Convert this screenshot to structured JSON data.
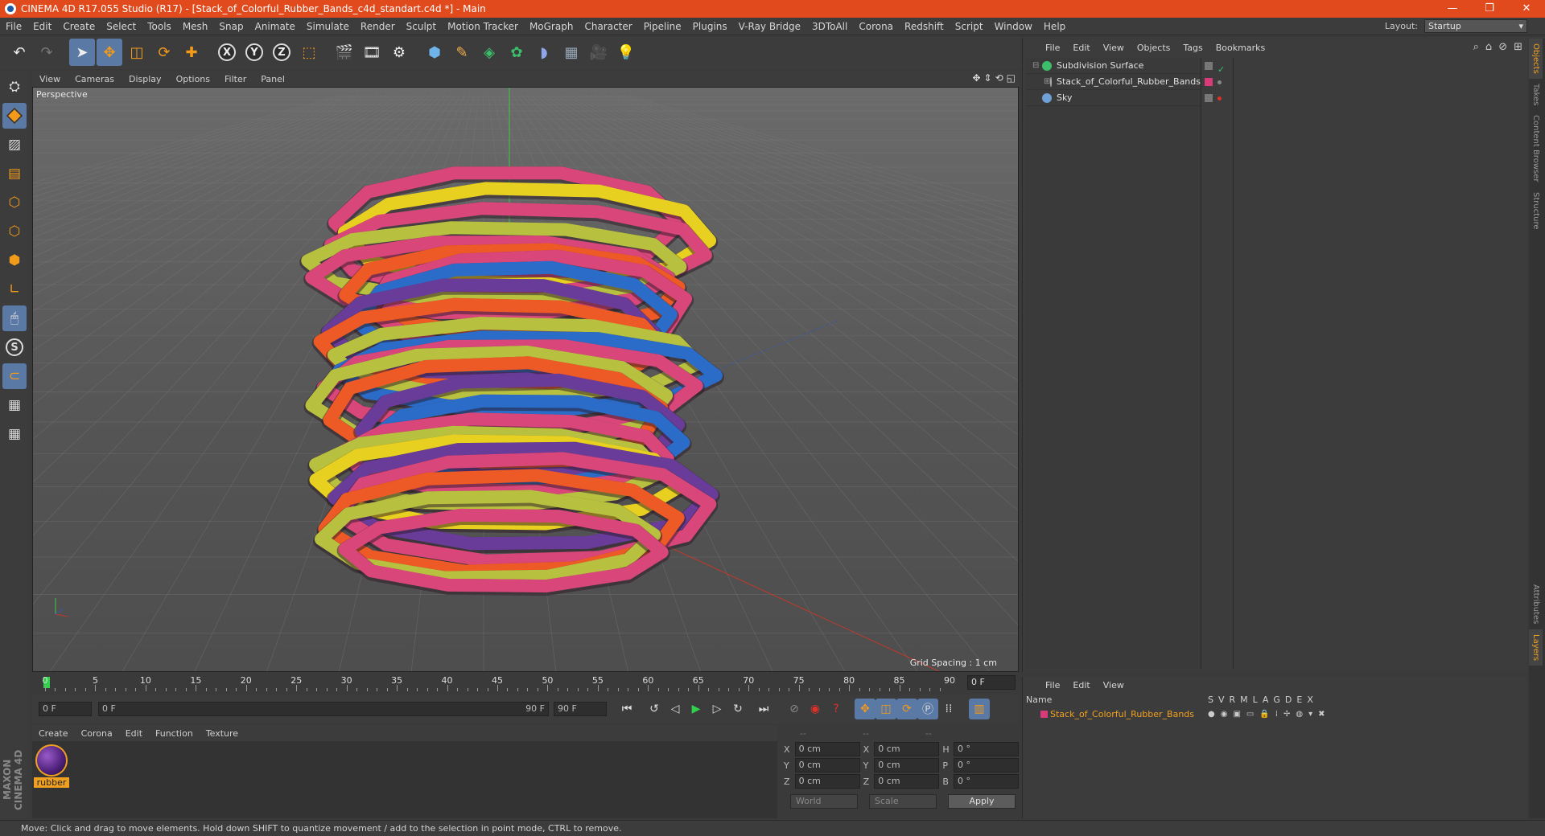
{
  "window": {
    "title": "CINEMA 4D R17.055 Studio (R17) - [Stack_of_Colorful_Rubber_Bands_c4d_standart.c4d *] - Main",
    "controls": [
      "—",
      "❐",
      "✕"
    ]
  },
  "menubar": {
    "items": [
      "File",
      "Edit",
      "Create",
      "Select",
      "Tools",
      "Mesh",
      "Snap",
      "Animate",
      "Simulate",
      "Render",
      "Sculpt",
      "Motion Tracker",
      "MoGraph",
      "Character",
      "Pipeline",
      "Plugins",
      "V-Ray Bridge",
      "3DToAll",
      "Corona",
      "Redshift",
      "Script",
      "Window",
      "Help"
    ],
    "layout_label": "Layout:",
    "layout_value": "Startup"
  },
  "viewport": {
    "menu": [
      "View",
      "Cameras",
      "Display",
      "Options",
      "Filter",
      "Panel"
    ],
    "camera_label": "Perspective",
    "grid_spacing": "Grid Spacing : 1 cm",
    "colors": {
      "pink": "#d8467a",
      "yellow": "#e8d020",
      "blue": "#2b6cc8",
      "orange": "#ee5a26",
      "purple": "#6a3c9a",
      "lime": "#b8c040"
    }
  },
  "timeline": {
    "ticks": [
      "0",
      "5",
      "10",
      "15",
      "20",
      "25",
      "30",
      "35",
      "40",
      "45",
      "50",
      "55",
      "60",
      "65",
      "70",
      "75",
      "80",
      "85",
      "90"
    ],
    "current_frame": "0 F"
  },
  "transport": {
    "start_field": "0 F",
    "range_start": "0 F",
    "range_end": "90 F",
    "end_field": "90 F"
  },
  "material_manager": {
    "menu": [
      "Create",
      "Corona",
      "Edit",
      "Function",
      "Texture"
    ],
    "materials": [
      {
        "name": "rubber"
      }
    ]
  },
  "coordinates": {
    "headers": [
      "--",
      "--",
      "--"
    ],
    "rows": [
      {
        "a": "X",
        "av": "0 cm",
        "b": "X",
        "bv": "0 cm",
        "c": "H",
        "cv": "0 °"
      },
      {
        "a": "Y",
        "av": "0 cm",
        "b": "Y",
        "bv": "0 cm",
        "c": "P",
        "cv": "0 °"
      },
      {
        "a": "Z",
        "av": "0 cm",
        "b": "Z",
        "bv": "0 cm",
        "c": "B",
        "cv": "0 °"
      }
    ],
    "mode": "World",
    "scale": "Scale",
    "apply": "Apply"
  },
  "object_manager": {
    "menu": [
      "File",
      "Edit",
      "View",
      "Objects",
      "Tags",
      "Bookmarks"
    ],
    "objects": [
      {
        "name": "Subdivision Surface",
        "color": "#3cbf6a"
      },
      {
        "name": "Stack_of_Colorful_Rubber_Bands",
        "color": "#aaaaaa"
      },
      {
        "name": "Sky",
        "color": "#6fa0d8"
      }
    ]
  },
  "layer_manager": {
    "menu": [
      "File",
      "Edit",
      "View"
    ],
    "name_header": "Name",
    "columns": [
      "S",
      "V",
      "R",
      "M",
      "L",
      "A",
      "G",
      "D",
      "E",
      "X"
    ],
    "layers": [
      {
        "name": "Stack_of_Colorful_Rubber_Bands",
        "color": "#d83a7a"
      }
    ]
  },
  "side_tabs": [
    "Objects",
    "Takes",
    "Content Browser",
    "Structure",
    "Attributes",
    "Layers"
  ],
  "status": "Move: Click and drag to move elements. Hold down SHIFT to quantize movement / add to the selection in point mode, CTRL to remove."
}
